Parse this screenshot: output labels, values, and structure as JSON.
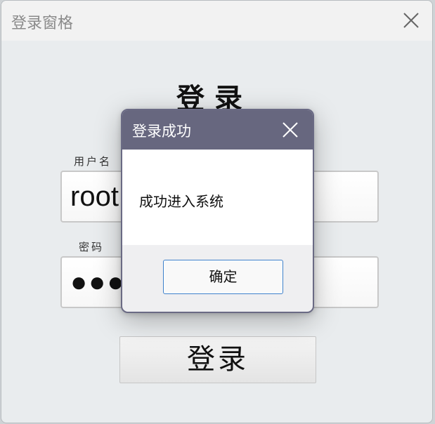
{
  "window": {
    "title": "登录窗格"
  },
  "form": {
    "heading": "登录",
    "username_label": "用户名",
    "username_value": "root",
    "password_label": "密码",
    "password_value": "●●●",
    "login_button": "登录"
  },
  "dialog": {
    "title": "登录成功",
    "message": "成功进入系统",
    "ok_button": "确定"
  },
  "colors": {
    "dialog_titlebar": "#67677f",
    "window_background": "#e9ecee",
    "ok_button_border": "#3c7fc9"
  }
}
